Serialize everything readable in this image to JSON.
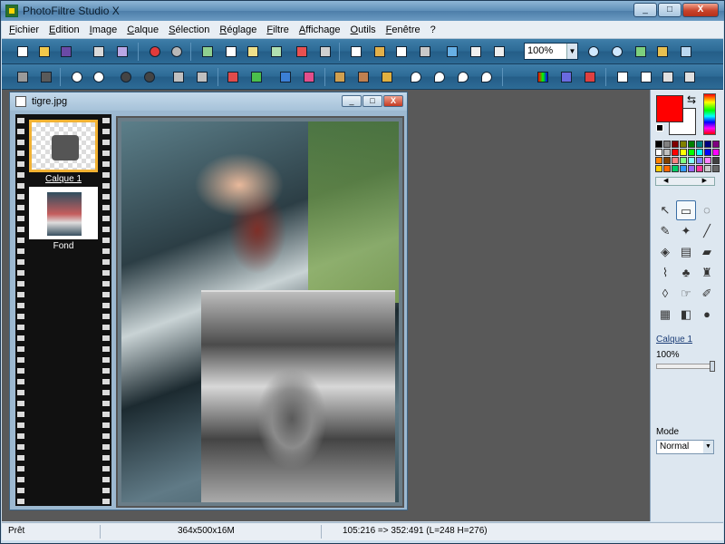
{
  "app": {
    "title": "PhotoFiltre Studio X"
  },
  "window_buttons": {
    "minimize": "_",
    "maximize": "□",
    "close": "X"
  },
  "menu": [
    {
      "mnemonic": "F",
      "rest": "ichier"
    },
    {
      "mnemonic": "E",
      "rest": "dition"
    },
    {
      "mnemonic": "I",
      "rest": "mage"
    },
    {
      "mnemonic": "C",
      "rest": "alque"
    },
    {
      "mnemonic": "S",
      "rest": "élection"
    },
    {
      "mnemonic": "R",
      "rest": "églage"
    },
    {
      "mnemonic": "F",
      "rest": "iltre"
    },
    {
      "mnemonic": "A",
      "rest": "ffichage"
    },
    {
      "mnemonic": "O",
      "rest": "utils"
    },
    {
      "mnemonic": "F",
      "rest": "enêtre"
    },
    {
      "mnemonic": "",
      "rest": "?"
    }
  ],
  "toolbar": {
    "zoom_value": "100%"
  },
  "document": {
    "title": "tigre.jpg"
  },
  "layers": [
    {
      "label": "Calque 1",
      "selected": true
    },
    {
      "label": "Fond",
      "selected": false
    }
  ],
  "palette": {
    "foreground_color": "#ff0000",
    "background_color": "#ffffff",
    "layer_link": "Calque 1",
    "opacity": "100%",
    "mode_label": "Mode",
    "mode_value": "Normal"
  },
  "swatch_colors": [
    "#000000",
    "#808080",
    "#800000",
    "#808000",
    "#008000",
    "#008080",
    "#000080",
    "#800080",
    "#ffffff",
    "#c0c0c0",
    "#ff0000",
    "#ffff00",
    "#00ff00",
    "#00ffff",
    "#0000ff",
    "#ff00ff",
    "#ff8000",
    "#804000",
    "#ff8080",
    "#80ff80",
    "#80ffff",
    "#8080ff",
    "#ff80ff",
    "#404040",
    "#ffcc00",
    "#ff6600",
    "#00cc66",
    "#3399ff",
    "#9966ff",
    "#ff3399",
    "#cccccc",
    "#666666"
  ],
  "status": {
    "state": "Prêt",
    "image_size": "364x500x16M",
    "selection": "105:216 => 352:491 (L=248  H=276)"
  }
}
